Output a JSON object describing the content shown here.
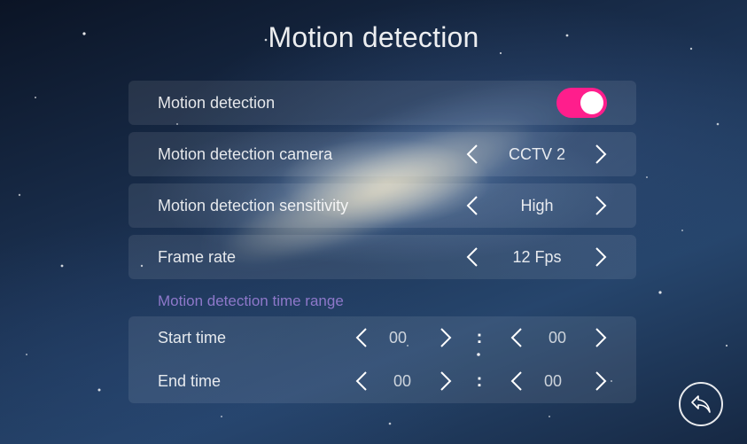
{
  "header": {
    "title": "Motion detection"
  },
  "settings": {
    "motion_detection": {
      "label": "Motion detection",
      "enabled": true
    },
    "camera": {
      "label": "Motion detection camera",
      "value": "CCTV 2"
    },
    "sensitivity": {
      "label": "Motion detection sensitivity",
      "value": "High"
    },
    "frame_rate": {
      "label": "Frame rate",
      "value": "12 Fps"
    }
  },
  "time_range": {
    "section_label": "Motion detection time range",
    "start": {
      "label": "Start time",
      "hour": "00",
      "minute": "00",
      "separator": ":"
    },
    "end": {
      "label": "End time",
      "hour": "00",
      "minute": "00",
      "separator": ":"
    }
  },
  "icons": {
    "toggle": "toggle-on-icon",
    "prev": "chevron-left-icon",
    "next": "chevron-right-icon",
    "back": "return-arrow-icon"
  },
  "colors": {
    "toggle_on": "#ff1e8c",
    "section_label": "#9a7fd6"
  }
}
